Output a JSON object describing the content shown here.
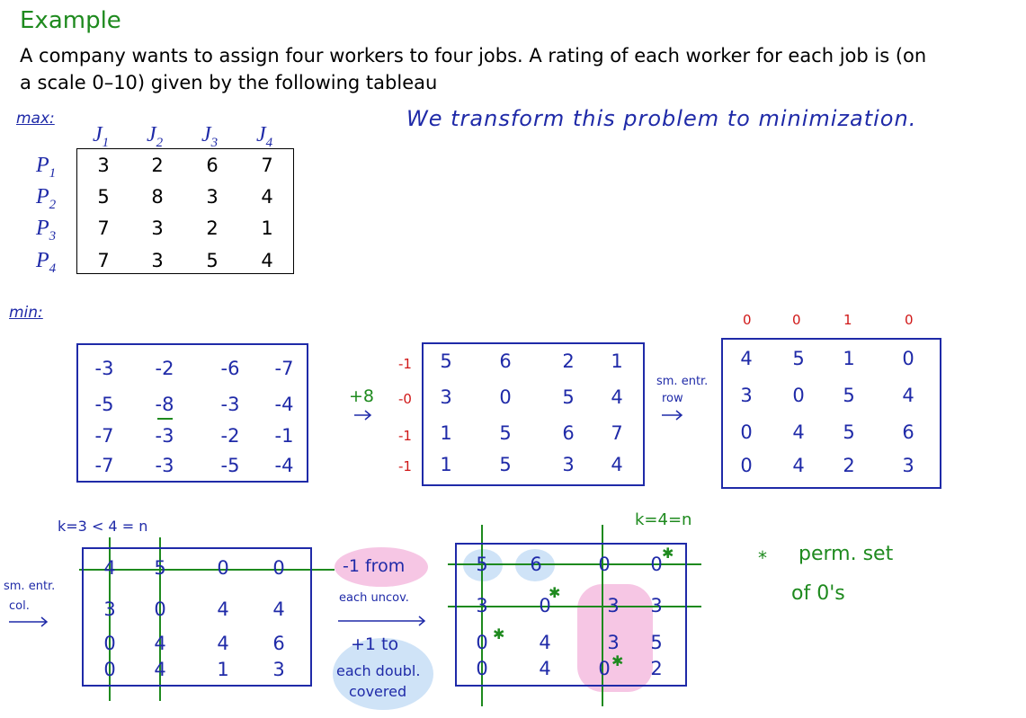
{
  "title": "Example",
  "intro": {
    "line1": "A company wants to assign four workers to four jobs. A rating of each worker for each job is (on",
    "line2": "a scale 0–10) given by the following tableau"
  },
  "labels": {
    "max": "max:",
    "min": "min:",
    "transform_note": "We transform this problem to minimization."
  },
  "rating_table": {
    "columns": [
      "J1",
      "J2",
      "J3",
      "J4"
    ],
    "rows": [
      {
        "label": "P1",
        "values": [
          "3",
          "2",
          "6",
          "7"
        ]
      },
      {
        "label": "P2",
        "values": [
          "5",
          "8",
          "3",
          "4"
        ]
      },
      {
        "label": "P3",
        "values": [
          "7",
          "3",
          "2",
          "1"
        ]
      },
      {
        "label": "P4",
        "values": [
          "7",
          "3",
          "5",
          "4"
        ]
      }
    ]
  },
  "matrix_neg": [
    [
      "-3",
      "-2",
      "-6",
      "-7"
    ],
    [
      "-5",
      "-8",
      "-3",
      "-4"
    ],
    [
      "-7",
      "-3",
      "-2",
      "-1"
    ],
    [
      "-7",
      "-3",
      "-5",
      "-4"
    ]
  ],
  "plus8_label": "+8",
  "matrix_plus8": {
    "row_subtract": [
      "-1",
      "-0",
      "-1",
      "-1"
    ],
    "values": [
      [
        "5",
        "6",
        "2",
        "1"
      ],
      [
        "3",
        "0",
        "5",
        "4"
      ],
      [
        "1",
        "5",
        "6",
        "7"
      ],
      [
        "1",
        "5",
        "3",
        "4"
      ]
    ]
  },
  "row_note": {
    "line1": "sm. entr.",
    "line2": "row"
  },
  "matrix_row_reduced": {
    "col_subtract": [
      "0",
      "0",
      "1",
      "0"
    ],
    "values": [
      [
        "4",
        "5",
        "1",
        "0"
      ],
      [
        "3",
        "0",
        "5",
        "4"
      ],
      [
        "0",
        "4",
        "5",
        "6"
      ],
      [
        "0",
        "4",
        "2",
        "3"
      ]
    ]
  },
  "k_label_1": "k=3 < 4 = n",
  "col_note": {
    "line1": "sm. entr.",
    "line2": "col."
  },
  "matrix_col_reduced": [
    [
      "4",
      "5",
      "0",
      "0"
    ],
    [
      "3",
      "0",
      "4",
      "4"
    ],
    [
      "0",
      "4",
      "4",
      "6"
    ],
    [
      "0",
      "4",
      "1",
      "3"
    ]
  ],
  "step_note": {
    "minus1_line1": "-1 from",
    "minus1_line2": "each uncov.",
    "plus1_line1": "+1 to",
    "plus1_line2": "each doubl.",
    "plus1_line3": "covered"
  },
  "k_label_2": "k=4=n",
  "matrix_final": [
    [
      "5",
      "6",
      "0",
      "0"
    ],
    [
      "3",
      "0",
      "3",
      "3"
    ],
    [
      "0",
      "4",
      "3",
      "5"
    ],
    [
      "0",
      "4",
      "0",
      "2"
    ]
  ],
  "final_stars": [
    [
      0,
      3
    ],
    [
      1,
      1
    ],
    [
      2,
      0
    ],
    [
      3,
      2
    ]
  ],
  "perm_note": {
    "star": "*",
    "line1": "perm. set",
    "line2": "of 0's"
  },
  "colors": {
    "ink_blue": "#1f2aa8",
    "ink_green": "#1e8a1e",
    "ink_red": "#d01818",
    "highlight_pink": "#f6c6e4",
    "highlight_blue": "#cfe3f7"
  }
}
